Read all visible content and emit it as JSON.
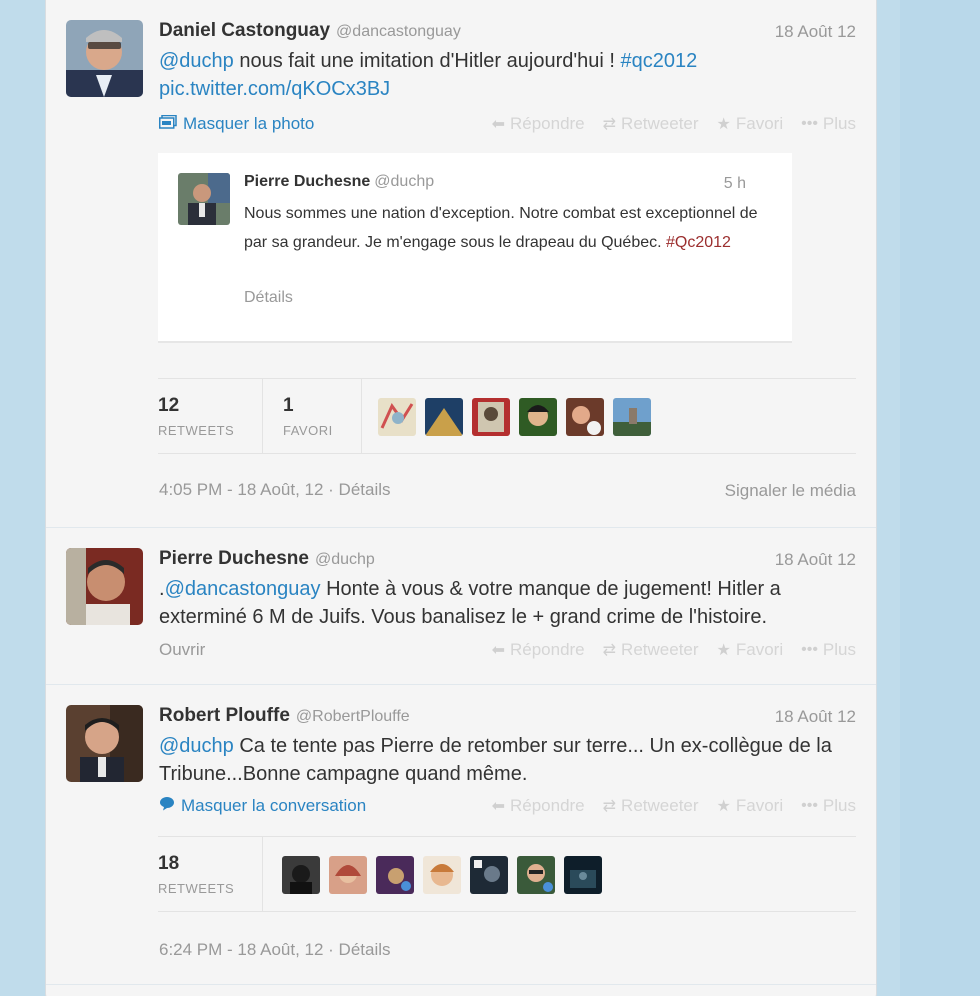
{
  "tweets": [
    {
      "name": "Daniel Castonguay",
      "handle": "@dancastonguay",
      "date": "18 Août 12",
      "mention": "@duchp",
      "text": " nous fait une imitation d'Hitler aujourd'hui ! ",
      "hashtag": "#qc2012",
      "piclink": "pic.twitter.com/qKOCx3BJ",
      "toggle_label": "Masquer la photo",
      "embed": {
        "name": "Pierre Duchesne",
        "handle": "@duchp",
        "time": "5 h",
        "text": "Nous sommes une nation d'exception. Notre combat est exceptionnel de par sa grandeur. Je m'engage sous le drapeau du Québec. ",
        "hashtag": "#Qc2012",
        "details": "Détails"
      },
      "retweets_count": "12",
      "retweets_label": "RETWEETS",
      "favorites_count": "1",
      "favorites_label": "FAVORI",
      "timestamp": "4:05 PM - 18 Août, 12 · Détails",
      "report_label": "Signaler le média"
    },
    {
      "name": "Pierre Duchesne",
      "handle": "@duchp",
      "date": "18 Août 12",
      "prefix": ".",
      "mention": "@dancastonguay",
      "text": " Honte à vous & votre manque de jugement! Hitler a exterminé 6 M de Juifs. Vous banalisez le + grand crime de l'histoire.",
      "open_label": "Ouvrir"
    },
    {
      "name": "Robert Plouffe",
      "handle": "@RobertPlouffe",
      "date": "18 Août 12",
      "mention": "@duchp",
      "text": " Ca te tente pas Pierre de retomber sur terre... Un ex-collègue de la Tribune...Bonne campagne quand même.",
      "toggle_label": "Masquer la conversation",
      "retweets_count": "18",
      "retweets_label": "RETWEETS",
      "timestamp": "6:24 PM - 18 Août, 12 · Détails"
    }
  ],
  "actions": {
    "reply": "Répondre",
    "retweet": "Retweeter",
    "favorite": "Favori",
    "more": "Plus"
  },
  "icons": {
    "reply": "reply-icon",
    "retweet": "retweet-icon",
    "favorite": "star-icon",
    "more": "more-dots-icon",
    "photo": "photo-icon",
    "conversation": "speech-bubble-icon"
  },
  "colors": {
    "link": "#2a84c2",
    "embed_hashtag": "#9b2e2e",
    "background": "#c0dceb"
  }
}
